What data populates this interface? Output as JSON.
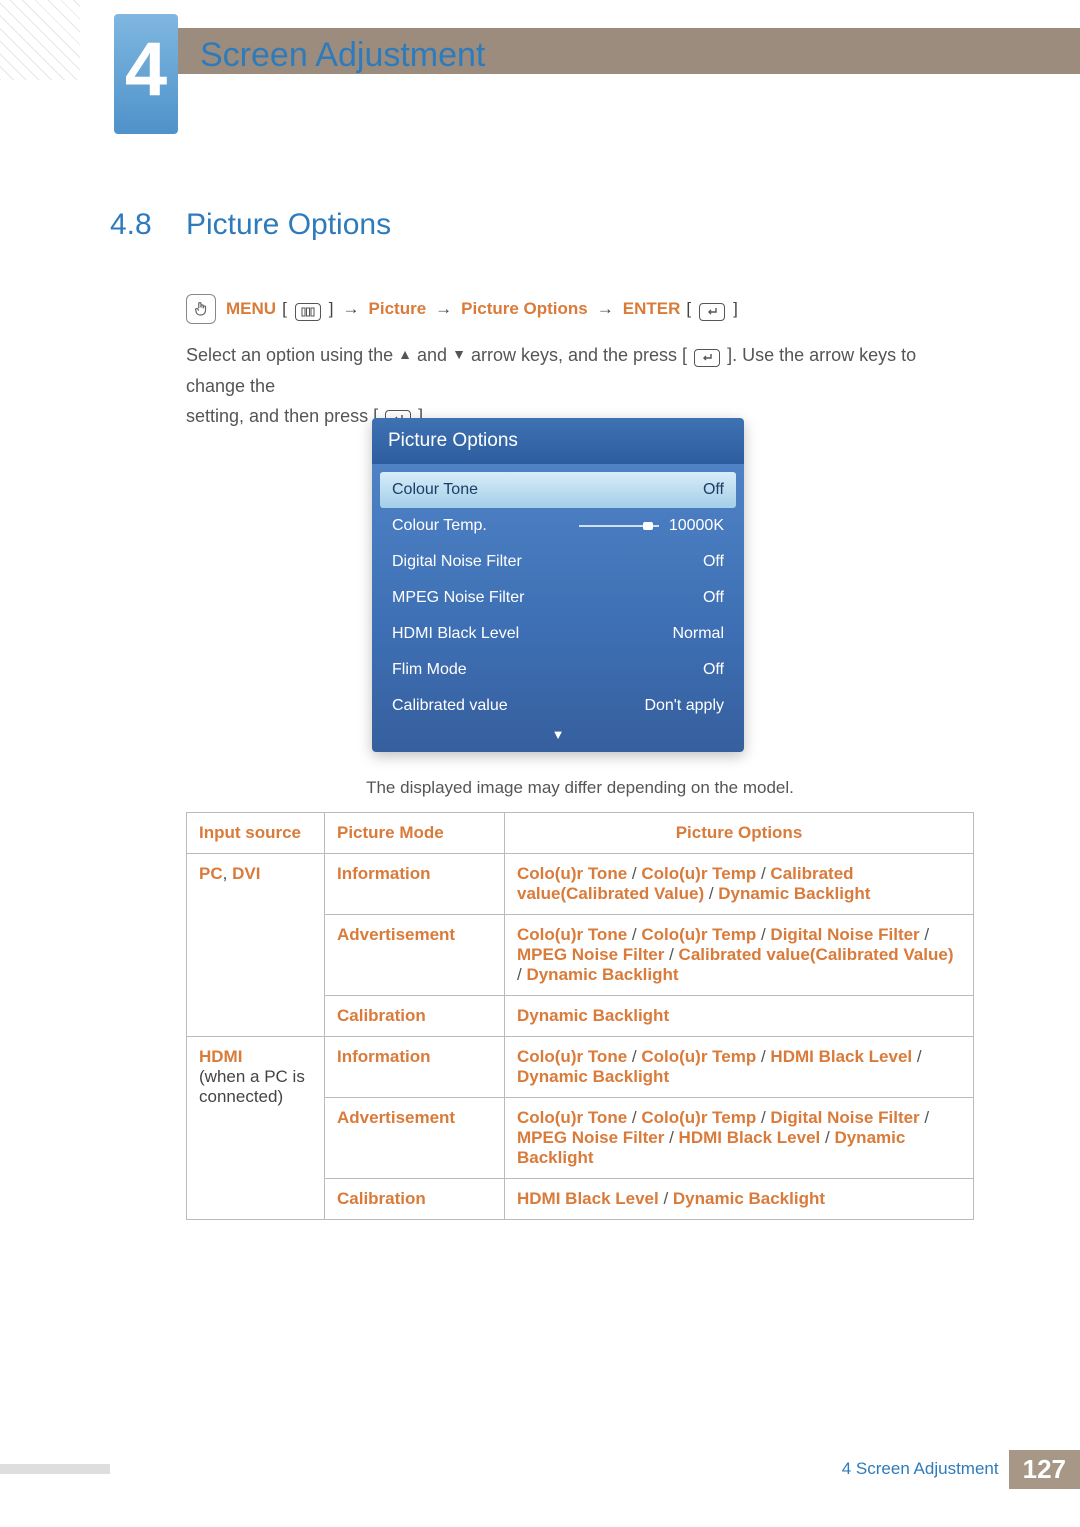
{
  "chapter": {
    "number": "4",
    "title": "Screen Adjustment"
  },
  "section": {
    "number": "4.8",
    "title": "Picture Options"
  },
  "breadcrumb": {
    "menu": "MENU",
    "picture": "Picture",
    "picture_options": "Picture Options",
    "enter": "ENTER"
  },
  "body": {
    "line1_a": "Select an option using the ",
    "line1_b": " and ",
    "line1_c": " arrow keys, and the press [",
    "line1_d": "]. Use the arrow keys to change the",
    "line2_a": "setting, and then press [",
    "line2_b": "]."
  },
  "osd": {
    "title": "Picture Options",
    "rows": [
      {
        "label": "Colour Tone",
        "value": "Off",
        "selected": true
      },
      {
        "label": "Colour Temp.",
        "value": "10000K",
        "slider": true
      },
      {
        "label": "Digital Noise Filter",
        "value": "Off"
      },
      {
        "label": "MPEG Noise Filter",
        "value": "Off"
      },
      {
        "label": "HDMI Black Level",
        "value": "Normal"
      },
      {
        "label": "Flim Mode",
        "value": "Off"
      },
      {
        "label": "Calibrated value",
        "value": "Don't apply"
      }
    ],
    "caption": "The displayed image may differ depending on the model."
  },
  "table": {
    "headers": {
      "c1": "Input source",
      "c2": "Picture Mode",
      "c3": "Picture Options"
    },
    "group1": {
      "src_a": "PC",
      "src_sep": ", ",
      "src_b": "DVI",
      "r1_mode": "Information",
      "r1_opts": [
        "Colo(u)r Tone",
        "Colo(u)r Temp",
        "Calibrated value",
        "(",
        "Calibrated Value",
        ")",
        "Dynamic Backlight"
      ],
      "r2_mode": "Advertisement",
      "r2_opts": [
        "Colo(u)r Tone",
        "Colo(u)r Temp",
        "Digital Noise Filter",
        "MPEG Noise Filter",
        "Calibrated value",
        "(",
        "Calibrated Value",
        ")",
        "Dynamic Backlight"
      ],
      "r3_mode": "Calibration",
      "r3_opts": [
        "Dynamic Backlight"
      ]
    },
    "group2": {
      "src_a": "HDMI",
      "src_note": "(when a PC is connected)",
      "r1_mode": "Information",
      "r1_opts": [
        "Colo(u)r Tone",
        "Colo(u)r Temp",
        "HDMI Black Level",
        "Dynamic Backlight"
      ],
      "r2_mode": "Advertisement",
      "r2_opts": [
        "Colo(u)r Tone",
        "Colo(u)r Temp",
        "Digital Noise Filter",
        "MPEG Noise Filter",
        "HDMI Black Level",
        "Dynamic Backlight"
      ],
      "r3_mode": "Calibration",
      "r3_opts": [
        "HDMI Black Level",
        "Dynamic Backlight"
      ]
    }
  },
  "footer": {
    "title": "4 Screen Adjustment",
    "page": "127"
  }
}
